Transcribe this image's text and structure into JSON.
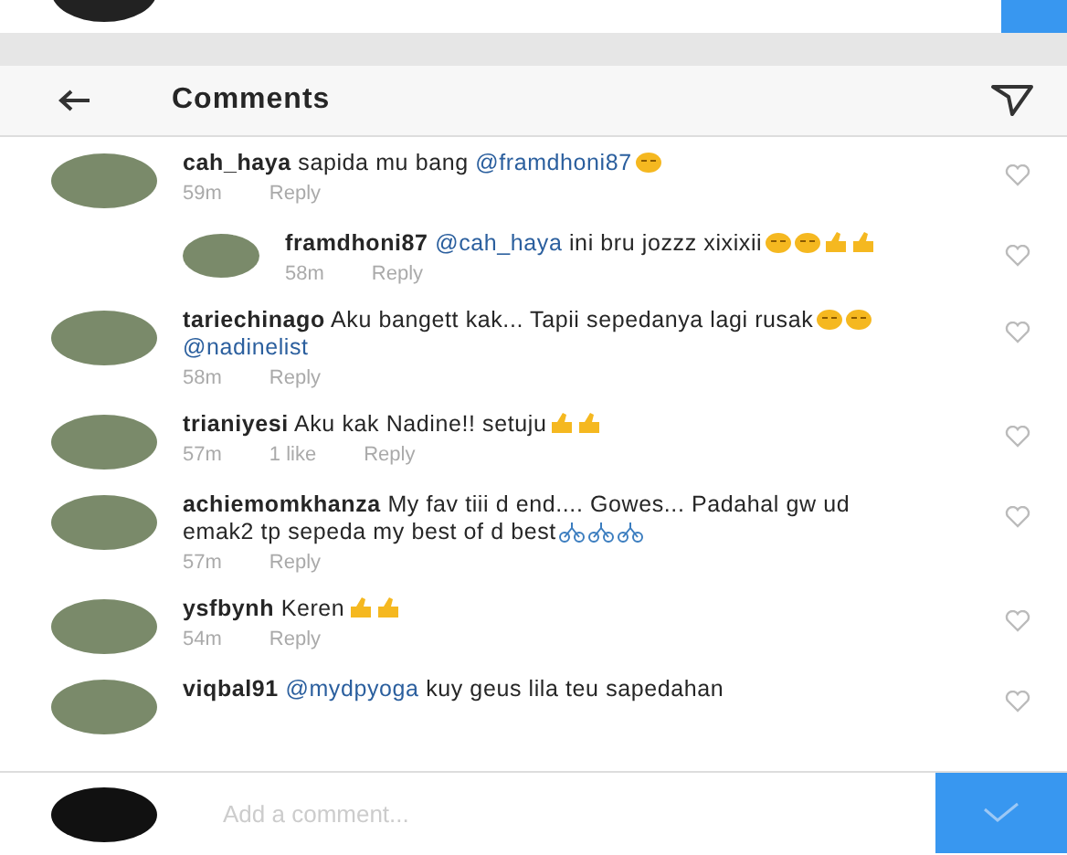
{
  "header": {
    "title": "Comments"
  },
  "comments": [
    {
      "user": "cah_haya",
      "parts": [
        {
          "kind": "text",
          "text": "sapida mu bang"
        },
        {
          "kind": "mention",
          "text": "@framdhoni87"
        },
        {
          "kind": "face"
        }
      ],
      "time": "59m",
      "reply": "Reply",
      "children": [
        {
          "user": "framdhoni87",
          "parts": [
            {
              "kind": "mention",
              "text": "@cah_haya"
            },
            {
              "kind": "text",
              "text": "ini bru jozzz xixixii"
            },
            {
              "kind": "face"
            },
            {
              "kind": "face"
            },
            {
              "kind": "hand"
            },
            {
              "kind": "hand"
            }
          ],
          "time": "58m",
          "reply": "Reply"
        }
      ]
    },
    {
      "user": "tariechinago",
      "parts": [
        {
          "kind": "text",
          "text": "Aku bangett kak... Tapii sepedanya lagi rusak"
        },
        {
          "kind": "face"
        },
        {
          "kind": "face"
        },
        {
          "kind": "mention",
          "text": "@nadinelist"
        }
      ],
      "time": "58m",
      "reply": "Reply"
    },
    {
      "user": "trianiyesi",
      "parts": [
        {
          "kind": "text",
          "text": "Aku kak Nadine!! setuju"
        },
        {
          "kind": "hand"
        },
        {
          "kind": "hand"
        }
      ],
      "time": "57m",
      "likes": "1 like",
      "reply": "Reply"
    },
    {
      "user": "achiemomkhanza",
      "parts": [
        {
          "kind": "text",
          "text": "My fav tiii d end.... Gowes... Padahal gw ud emak2 tp sepeda my best of d best"
        },
        {
          "kind": "bike"
        },
        {
          "kind": "bike"
        },
        {
          "kind": "bike"
        }
      ],
      "time": "57m",
      "reply": "Reply"
    },
    {
      "user": "ysfbynh",
      "parts": [
        {
          "kind": "text",
          "text": "Keren"
        },
        {
          "kind": "hand"
        },
        {
          "kind": "hand"
        }
      ],
      "time": "54m",
      "reply": "Reply"
    },
    {
      "user": "viqbal91",
      "parts": [
        {
          "kind": "mention",
          "text": "@mydpyoga"
        },
        {
          "kind": "text",
          "text": "kuy geus lila teu sapedahan"
        }
      ]
    }
  ],
  "composer": {
    "placeholder": "Add a comment..."
  }
}
